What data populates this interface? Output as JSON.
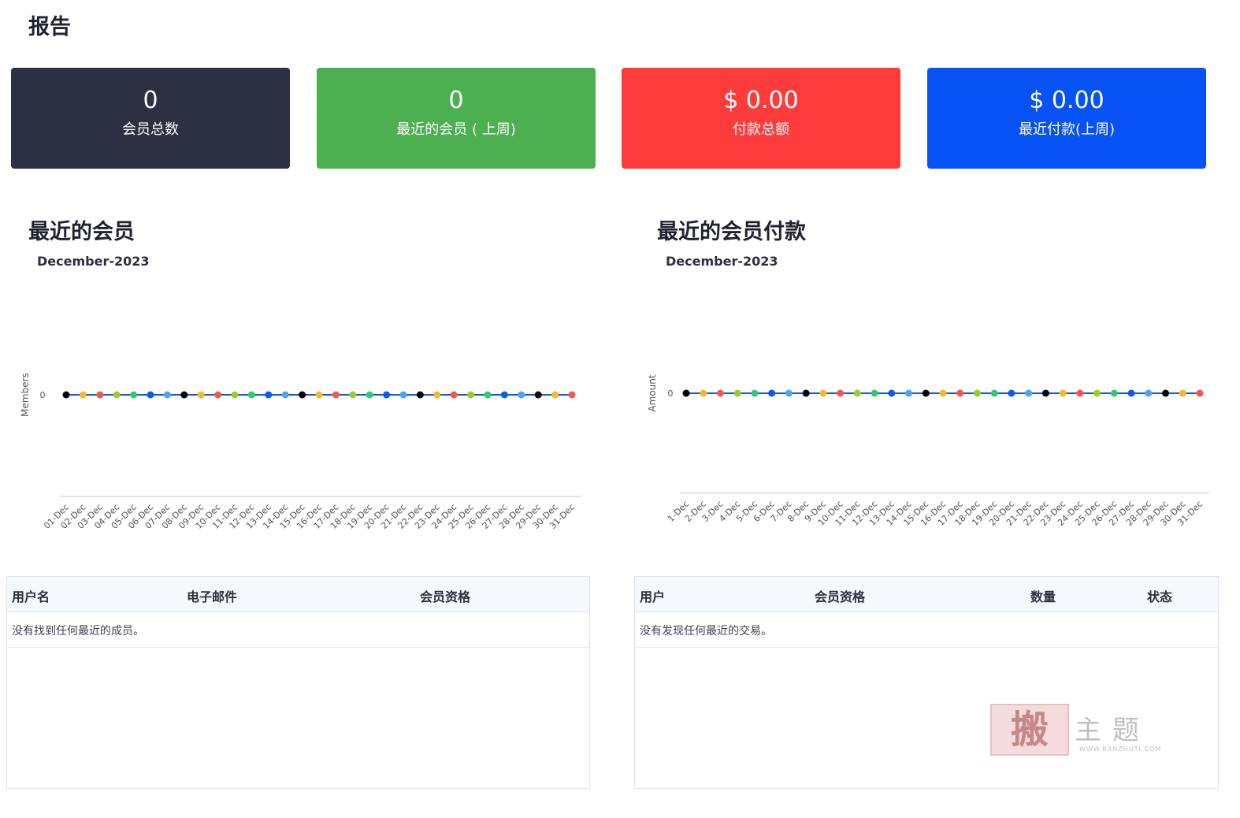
{
  "page_title": "报告",
  "cards": [
    {
      "value": "0",
      "label": "会员总数",
      "color": "#2d2f42"
    },
    {
      "value": "0",
      "label": "最近的会员 ( 上周)",
      "color": "#4caf50"
    },
    {
      "value": "$ 0.00",
      "label": "付款总额",
      "color": "#ff3b3b"
    },
    {
      "value": "$ 0.00",
      "label": "最近付款(上周)",
      "color": "#0652f5"
    }
  ],
  "members_section": {
    "title": "最近的会员"
  },
  "payments_section": {
    "title": "最近的会员付款"
  },
  "chart_data": [
    {
      "type": "line",
      "title": "December-2023",
      "ylabel": "Members",
      "xlabel": "",
      "categories": [
        "01-Dec",
        "02-Dec",
        "03-Dec",
        "04-Dec",
        "05-Dec",
        "06-Dec",
        "07-Dec",
        "08-Dec",
        "09-Dec",
        "10-Dec",
        "11-Dec",
        "12-Dec",
        "13-Dec",
        "14-Dec",
        "15-Dec",
        "16-Dec",
        "17-Dec",
        "18-Dec",
        "19-Dec",
        "20-Dec",
        "21-Dec",
        "22-Dec",
        "23-Dec",
        "24-Dec",
        "25-Dec",
        "26-Dec",
        "27-Dec",
        "28-Dec",
        "29-Dec",
        "30-Dec",
        "31-Dec"
      ],
      "series": [
        {
          "values": [
            0,
            0,
            0,
            0,
            0,
            0,
            0,
            0,
            0,
            0,
            0,
            0,
            0,
            0,
            0,
            0,
            0,
            0,
            0,
            0,
            0,
            0,
            0,
            0,
            0,
            0,
            0,
            0,
            0,
            0,
            0
          ]
        }
      ],
      "yticks": [
        "0"
      ],
      "line_color": "#1a56db",
      "point_colors": [
        "#000000",
        "#f7b924",
        "#f5584a",
        "#9bce24",
        "#2ecc71",
        "#0a5cf0",
        "#4da3f7"
      ]
    },
    {
      "type": "line",
      "title": "December-2023",
      "ylabel": "Amount",
      "xlabel": "",
      "categories": [
        "1-Dec",
        "2-Dec",
        "3-Dec",
        "4-Dec",
        "5-Dec",
        "6-Dec",
        "7-Dec",
        "8-Dec",
        "9-Dec",
        "10-Dec",
        "11-Dec",
        "12-Dec",
        "13-Dec",
        "14-Dec",
        "15-Dec",
        "16-Dec",
        "17-Dec",
        "18-Dec",
        "19-Dec",
        "20-Dec",
        "21-Dec",
        "22-Dec",
        "23-Dec",
        "24-Dec",
        "25-Dec",
        "26-Dec",
        "27-Dec",
        "28-Dec",
        "29-Dec",
        "30-Dec",
        "31-Dec"
      ],
      "series": [
        {
          "values": [
            0,
            0,
            0,
            0,
            0,
            0,
            0,
            0,
            0,
            0,
            0,
            0,
            0,
            0,
            0,
            0,
            0,
            0,
            0,
            0,
            0,
            0,
            0,
            0,
            0,
            0,
            0,
            0,
            0,
            0,
            0
          ]
        }
      ],
      "yticks": [
        "0"
      ],
      "line_color": "#1a56db",
      "point_colors": [
        "#000000",
        "#f7b924",
        "#f5584a",
        "#9bce24",
        "#2ecc71",
        "#0a5cf0",
        "#4da3f7"
      ]
    }
  ],
  "members_table": {
    "headers": [
      "用户名",
      "电子邮件",
      "会员资格"
    ],
    "empty_message": "没有找到任何最近的成员。"
  },
  "payments_table": {
    "headers": [
      "用户",
      "会员资格",
      "数量",
      "状态"
    ],
    "empty_message": "没有发现任何最近的交易。"
  },
  "watermark": {
    "logo_char": "搬",
    "text": "主题",
    "url": "WWW.BANZHUTI.COM"
  }
}
